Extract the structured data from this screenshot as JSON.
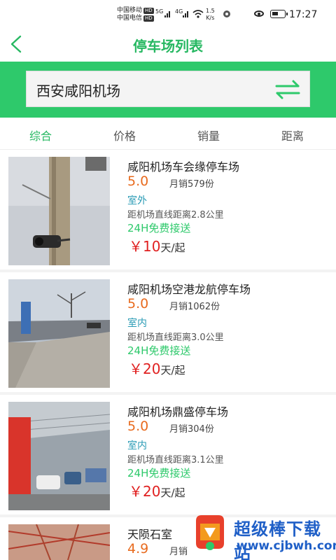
{
  "status_bar": {
    "carrier_1": "中国移动",
    "carrier_2": "中国电信",
    "hd_badge": "HD",
    "signal_1": "5G",
    "signal_2": "4G",
    "net_speed_value": "1.5",
    "net_speed_unit": "K/s",
    "time": "17:27"
  },
  "nav": {
    "title": "停车场列表"
  },
  "search": {
    "value": "西安咸阳机场"
  },
  "sort_tabs": [
    {
      "label": "综合",
      "active": true
    },
    {
      "label": "价格",
      "active": false
    },
    {
      "label": "销量",
      "active": false
    },
    {
      "label": "距离",
      "active": false
    }
  ],
  "items": [
    {
      "name": "咸阳机场车会缘停车场",
      "rating": "5.0",
      "sales": "月销579份",
      "type": "室外",
      "distance": "距机场直线距离2.8公里",
      "shuttle": "24H免费接送",
      "price_symbol": "￥",
      "price": "10",
      "price_unit": "天/起"
    },
    {
      "name": "咸阳机场空港龙航停车场",
      "rating": "5.0",
      "sales": "月销1062份",
      "type": "室内",
      "distance": "距机场直线距离3.0公里",
      "shuttle": "24H免费接送",
      "price_symbol": "￥",
      "price": "20",
      "price_unit": "天/起"
    },
    {
      "name": "咸阳机场鼎盛停车场",
      "rating": "5.0",
      "sales": "月销304份",
      "type": "室内",
      "distance": "距机场直线距离3.1公里",
      "shuttle": "24H免费接送",
      "price_symbol": "￥",
      "price": "20",
      "price_unit": "天/起"
    },
    {
      "name": "天陨石室",
      "rating": "4.9",
      "sales": "月销",
      "type": "",
      "distance": "",
      "shuttle": "",
      "price_symbol": "",
      "price": "",
      "price_unit": ""
    }
  ],
  "watermark": {
    "title": "超级棒下载站",
    "url": "www.cjbwh.com"
  },
  "colors": {
    "accent_green": "#2ec96b",
    "title_green": "#27b862",
    "rating_orange": "#e86b1f",
    "price_red": "#e02020",
    "type_blue": "#2a9bb5"
  },
  "icons": {
    "back": "back-icon",
    "swap": "swap-icon",
    "eye": "eye-icon",
    "battery": "battery-icon",
    "wifi": "wifi-icon"
  }
}
